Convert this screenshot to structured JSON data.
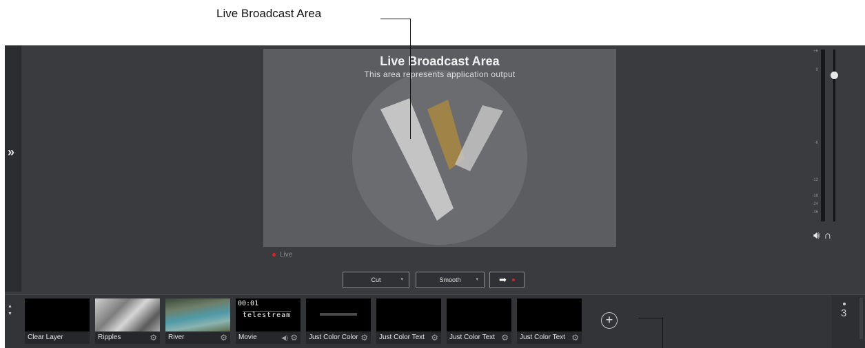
{
  "callout": {
    "label": "Live Broadcast Area"
  },
  "preview": {
    "title": "Live Broadcast Area",
    "subtitle": "This area represents application output"
  },
  "status": {
    "live_label": "Live"
  },
  "transition": {
    "cut_label": "Cut",
    "smooth_label": "Smooth",
    "go_icon": "arrow-right-icon"
  },
  "meter": {
    "scale": [
      "+6",
      "0",
      "-6",
      "-12",
      "-18",
      "-24",
      "-36"
    ],
    "fader_db": 0
  },
  "shots": [
    {
      "label": "Clear Layer",
      "thumb": "black",
      "gear": false,
      "audio": false
    },
    {
      "label": "Ripples",
      "thumb": "water-ripples",
      "gear": true,
      "audio": false
    },
    {
      "label": "River",
      "thumb": "river",
      "gear": true,
      "audio": false
    },
    {
      "label": "Movie",
      "thumb": "telestream-logo",
      "timer": "00:01",
      "logo_text": "telestream",
      "gear": true,
      "audio": true
    },
    {
      "label": "Just Color Color",
      "thumb": "color-bar",
      "gear": true,
      "audio": false
    },
    {
      "label": "Just Color Text",
      "thumb": "black",
      "gear": true,
      "audio": false
    },
    {
      "label": "Just Color Text",
      "thumb": "black",
      "gear": true,
      "audio": false
    },
    {
      "label": "Just Color Text",
      "thumb": "black",
      "gear": true,
      "audio": false
    }
  ],
  "pager": {
    "current": "3"
  },
  "colors": {
    "background": "#3a3b3e",
    "preview": "#5c5d61",
    "live_dot": "#e02020",
    "logo_gold": "#b08a3c"
  }
}
